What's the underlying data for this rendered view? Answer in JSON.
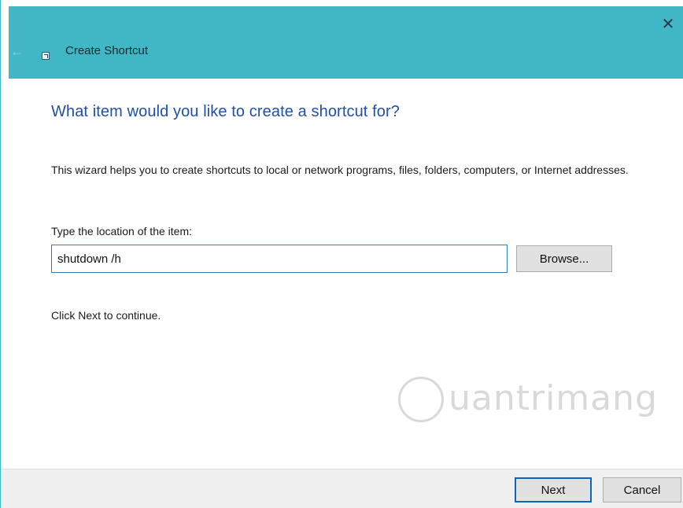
{
  "window": {
    "title": "Create Shortcut",
    "close_glyph": "✕",
    "back_glyph": "←",
    "accent_color": "#41b6c4"
  },
  "main": {
    "heading": "What item would you like to create a shortcut for?",
    "description": "This wizard helps you to create shortcuts to local or network programs, files, folders, computers, or Internet addresses.",
    "location_label": "Type the location of the item:",
    "location_value": "shutdown /h",
    "browse_label": "Browse...",
    "hint": "Click Next to continue."
  },
  "watermark": {
    "text": "uantrimang"
  },
  "footer": {
    "next_label": "Next",
    "cancel_label": "Cancel"
  }
}
